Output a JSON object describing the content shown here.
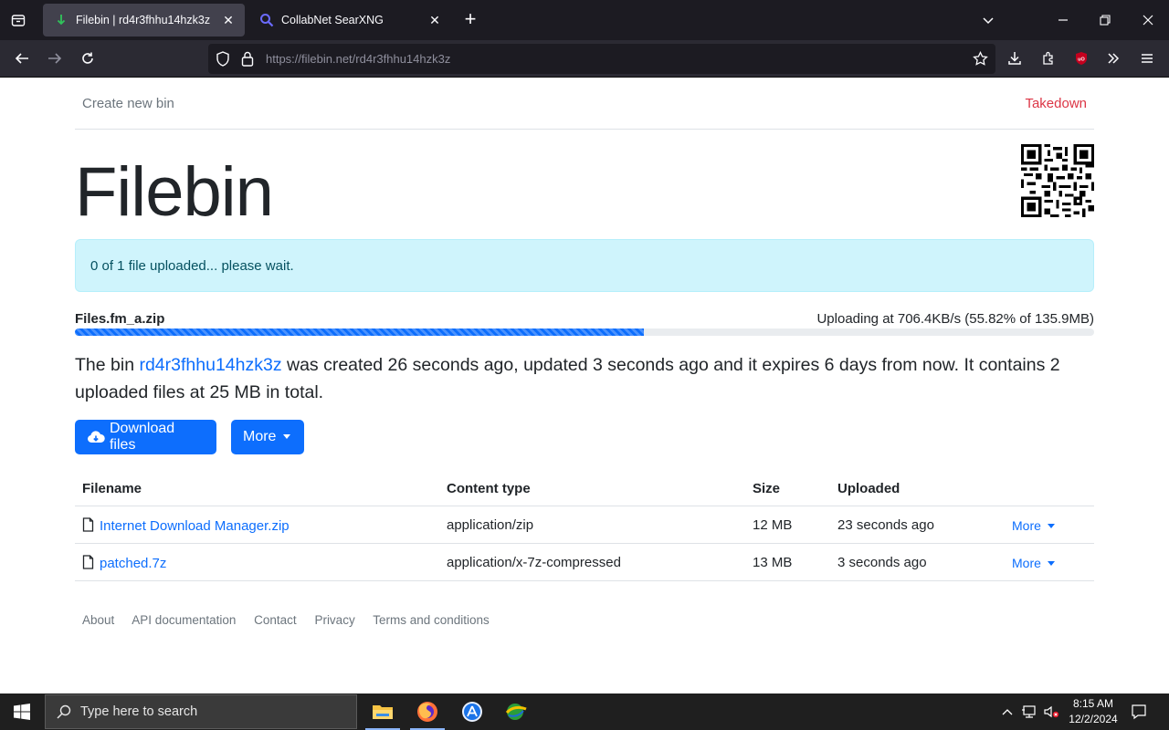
{
  "browser": {
    "tabs": [
      {
        "title": "Filebin | rd4r3fhhu14hzk3z",
        "active": true
      },
      {
        "title": "CollabNet SearXNG",
        "active": false
      }
    ],
    "url_domain": "https://filebin.net/",
    "url_path": "rd4r3fhhu14hzk3z"
  },
  "nav": {
    "create": "Create new bin",
    "takedown": "Takedown"
  },
  "brand": "Filebin",
  "alert": "0 of 1 file uploaded... please wait.",
  "upload": {
    "filename": "Files.fm_a.zip",
    "status": "Uploading at 706.4KB/s (55.82% of 135.9MB)",
    "progress_percent": 55.82
  },
  "lead": {
    "prefix": "The bin ",
    "bin_id": "rd4r3fhhu14hzk3z",
    "suffix": " was created 26 seconds ago, updated 3 seconds ago and it expires 6 days from now. It contains 2 uploaded files at 25 MB in total."
  },
  "buttons": {
    "download": "Download files",
    "more": "More"
  },
  "table": {
    "headers": [
      "Filename",
      "Content type",
      "Size",
      "Uploaded"
    ],
    "rows": [
      {
        "filename": "Internet Download Manager.zip",
        "type": "application/zip",
        "size": "12 MB",
        "uploaded": "23 seconds ago",
        "more": "More"
      },
      {
        "filename": "patched.7z",
        "type": "application/x-7z-compressed",
        "size": "13 MB",
        "uploaded": "3 seconds ago",
        "more": "More"
      }
    ]
  },
  "footer": [
    "About",
    "API documentation",
    "Contact",
    "Privacy",
    "Terms and conditions"
  ],
  "taskbar": {
    "search_placeholder": "Type here to search",
    "time": "8:15 AM",
    "date": "12/2/2024"
  },
  "colors": {
    "primary": "#0d6efd",
    "danger": "#dc3545",
    "alert_bg": "#cff4fc",
    "alert_text": "#055160"
  }
}
